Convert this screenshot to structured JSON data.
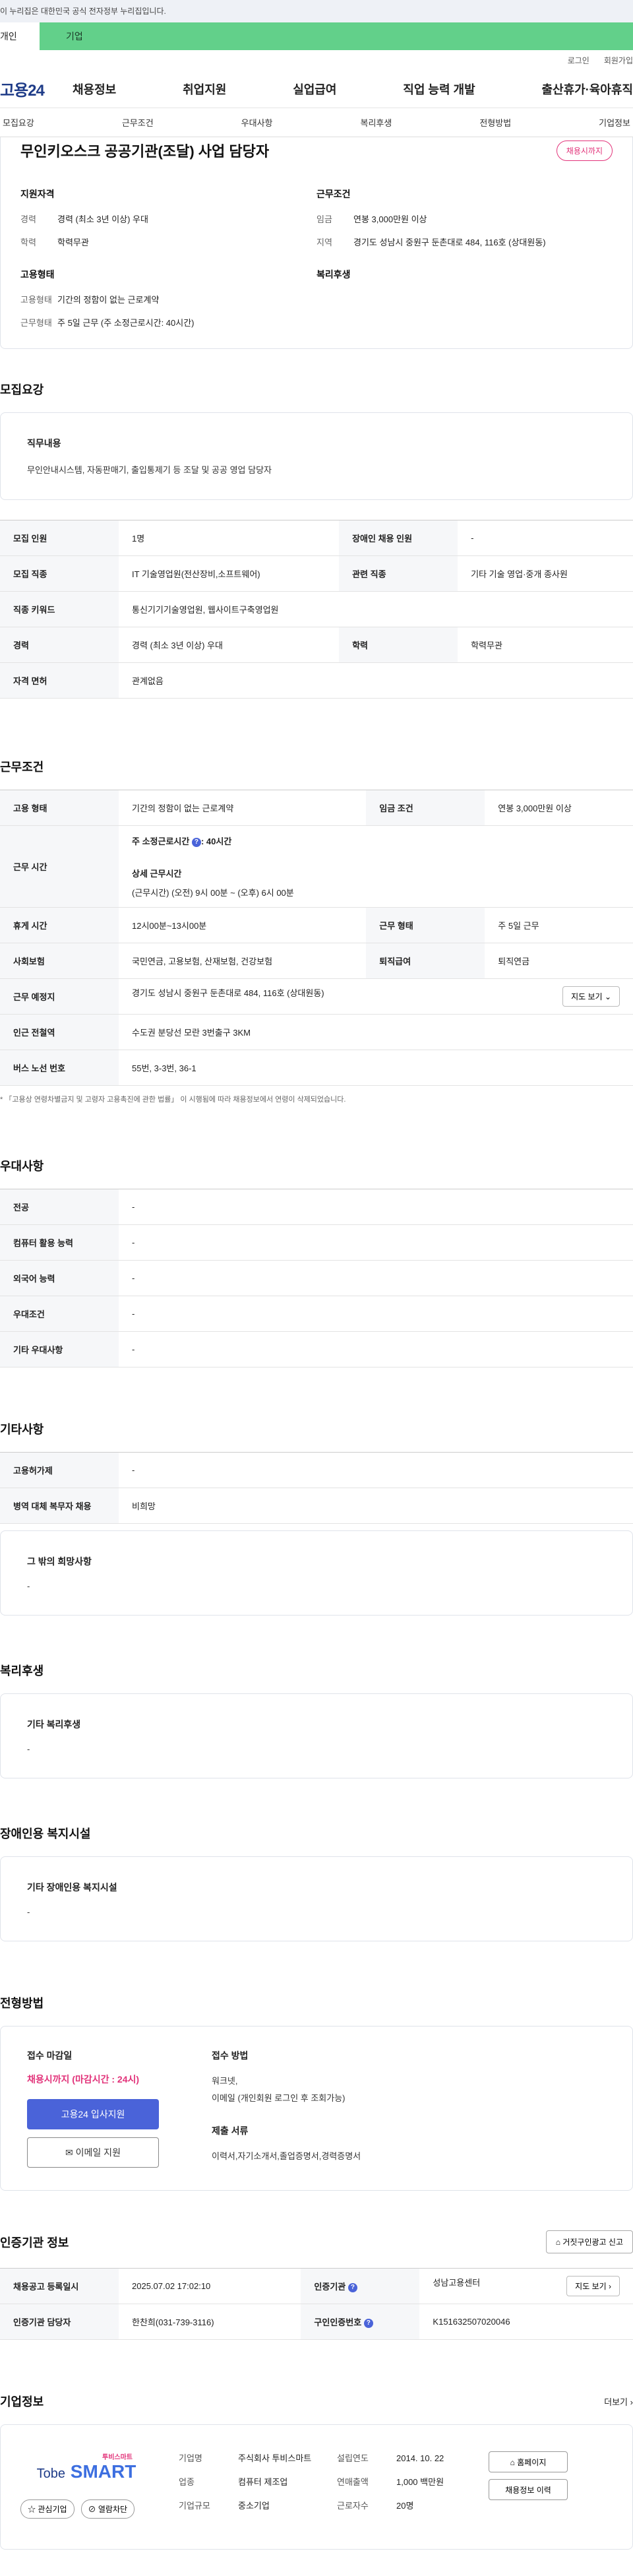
{
  "gov_banner": "이 누리집은 대한민국 공식 전자정부 누리집입니다.",
  "user_tabs": {
    "person": "개인",
    "company": "기업"
  },
  "util": {
    "login": "로그인",
    "join": "회원가입"
  },
  "gnb": {
    "logo": "고용24",
    "menu": [
      "채용정보",
      "취업지원",
      "실업급여",
      "직업 능력 개발",
      "출산휴가·육아휴직"
    ]
  },
  "subnav": [
    "모집요강",
    "근무조건",
    "우대사항",
    "복리후생",
    "전형방법",
    "기업정보"
  ],
  "summary": {
    "title": "무인키오스크 공공기관(조달) 사업 담당자",
    "badge": "채용시까지",
    "qual_head": "지원자격",
    "qual": [
      {
        "k": "경력",
        "v": "경력 (최소 3년 이상) 우대"
      },
      {
        "k": "학력",
        "v": "학력무관"
      }
    ],
    "emp_head": "고용형태",
    "emp": [
      {
        "k": "고용형태",
        "v": "기간의 정함이 없는 근로계약"
      },
      {
        "k": "근무형태",
        "v": "주 5일 근무 (주 소정근로시간: 40시간)"
      }
    ],
    "cond_head": "근무조건",
    "cond": [
      {
        "k": "임금",
        "v": "연봉 3,000만원 이상"
      },
      {
        "k": "지역",
        "v": "경기도 성남시 중원구 둔촌대로 484, 116호 (상대원동)"
      }
    ],
    "welfare_head": "복리후생"
  },
  "recruit": {
    "title": "모집요강",
    "duty_head": "직무내용",
    "duty_body": "무인안내시스템, 자동판매기, 출입통제기 등 조달 및 공공 영업 담당자",
    "rows": [
      {
        "k1": "모집 인원",
        "v1": "1명",
        "k2": "장애인 채용 인원",
        "v2": "-"
      },
      {
        "k1": "모집 직종",
        "v1": "IT 기술영업원(전산장비,소프트웨어)",
        "k2": "관련 직종",
        "v2": "기타 기술 영업·중개 종사원"
      },
      {
        "k1": "직종 키워드",
        "v1": "통신기기기술영업원, 웹사이트구축영업원"
      },
      {
        "k1": "경력",
        "v1": "경력 (최소 3년 이상) 우대",
        "k2": "학력",
        "v2": "학력무관"
      },
      {
        "k1": "자격 면허",
        "v1": "관계없음"
      }
    ]
  },
  "work": {
    "title": "근무조건",
    "emp_type_k": "고용 형태",
    "emp_type_v": "기간의 정함이 없는 근로계약",
    "wage_k": "임금 조건",
    "wage_v": "연봉 3,000만원 이상",
    "hours_k": "근무 시간",
    "hours_line1": "주 소정근로시간",
    "hours_line1_val": ": 40시간",
    "hours_detail_head": "상세 근무시간",
    "hours_detail": "(근무시간) (오전) 9시 00분 ~ (오후) 6시 00분",
    "break_k": "휴게 시간",
    "break_v": "12시00분~13시00분",
    "form_k": "근무 형태",
    "form_v": "주 5일 근무",
    "insur_k": "사회보험",
    "insur_v": "국민연금, 고용보험, 산재보험, 건강보험",
    "sev_k": "퇴직급여",
    "sev_v": "퇴직연금",
    "place_k": "근무 예정지",
    "place_v": "경기도 성남시 중원구 둔촌대로 484, 116호 (상대원동)",
    "map_btn": "지도 보기",
    "subway_k": "인근 전철역",
    "subway_v": "수도권 분당선 모란 3번출구 3KM",
    "bus_k": "버스 노선 번호",
    "bus_v": "55번, 3-3번, 36-1",
    "note": "* 「고용상 연령차별금지 및 고령자 고용촉진에 관한 법률」 이 시행됨에 따라 채용정보에서 연령이 삭제되었습니다."
  },
  "pref": {
    "title": "우대사항",
    "rows": [
      {
        "k": "전공",
        "v": "-"
      },
      {
        "k": "컴퓨터 활용 능력",
        "v": "-"
      },
      {
        "k": "외국어 능력",
        "v": "-"
      },
      {
        "k": "우대조건",
        "v": "-"
      },
      {
        "k": "기타 우대사항",
        "v": "-"
      }
    ]
  },
  "etc": {
    "title": "기타사항",
    "rows": [
      {
        "k": "고용허가제",
        "v": "-"
      },
      {
        "k": "병역 대체 복무자 채용",
        "v": "비희망"
      }
    ],
    "other_head": "그 밖의 희망사항",
    "other_body": "-"
  },
  "welfare": {
    "title": "복리후생",
    "head": "기타 복리후생",
    "body": "-"
  },
  "disabled": {
    "title": "장애인용 복지시설",
    "head": "기타 장애인용 복지시설",
    "body": "-"
  },
  "process": {
    "title": "전형방법",
    "deadline_head": "접수 마감일",
    "deadline": "채용시까지 (마감시간 : 24시)",
    "apply_btn": "고용24 입사지원",
    "email_btn": "이메일 지원",
    "method_head": "접수 방법",
    "method_1": "워크넷,",
    "method_2": "이메일 (개인회원 로그인 후 조회가능)",
    "docs_head": "제출 서류",
    "docs": "이력서,자기소개서,졸업증명서,경력증명서"
  },
  "agency": {
    "title": "인증기관 정보",
    "report_btn": "거짓구인광고 신고",
    "reg_k": "채용공고 등록일시",
    "reg_v": "2025.07.02 17:02:10",
    "org_k": "인증기관",
    "org_v": "성남고용센터",
    "map_btn": "지도 보기",
    "mgr_k": "인증기관 담당자",
    "mgr_v": "한찬희(031-739-3116)",
    "num_k": "구인인증번호",
    "num_v": "K151632507020046"
  },
  "company": {
    "title": "기업정보",
    "more": "더보기",
    "logo_top": "투비스마트",
    "logo_tobe": "Tobe",
    "logo_smart": "SMART",
    "fav_btn": "관심기업",
    "block_btn": "열람차단",
    "name_k": "기업명",
    "name_v": "주식회사 투비스마트",
    "industry_k": "업종",
    "industry_v": "컴퓨터 제조업",
    "size_k": "기업규모",
    "size_v": "중소기업",
    "year_k": "설립연도",
    "year_v": "2014. 10. 22",
    "sales_k": "연매출액",
    "sales_v": "1,000 백만원",
    "emp_k": "근로자수",
    "emp_v": "20명",
    "home_btn": "홈페이지",
    "jobs_btn": "채용정보 이력"
  }
}
